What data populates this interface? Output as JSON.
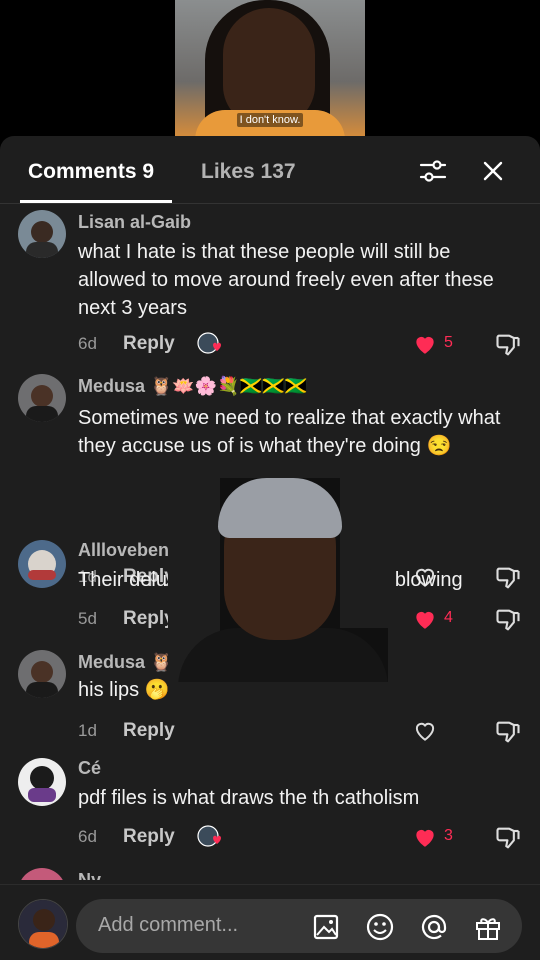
{
  "video": {
    "caption": "I don't know."
  },
  "tabs": {
    "comments_label": "Comments 9",
    "likes_label": "Likes 137"
  },
  "icons": {
    "filter": "sliders-icon",
    "close": "close-icon",
    "like": "heart-icon",
    "dislike": "thumbs-down-icon",
    "creator": "creator-loved-badge-icon",
    "image": "image-icon",
    "emoji": "emoji-icon",
    "mention": "at-sign-icon",
    "gift": "gift-icon"
  },
  "colors": {
    "like_active": "#fe2c55",
    "background": "#1e1e1e"
  },
  "comments": [
    {
      "name": "Lisan al-Gaib",
      "text": "what I hate is that these people will still be allowed to move around freely even after these next 3 years",
      "age": "6d",
      "reply": "Reply",
      "likes": "5",
      "liked": true,
      "creator_liked": true
    },
    {
      "name": "Medusa 🦉🪷🌸💐🇯🇲🇯🇲🇯🇲",
      "text": "Sometimes we need to realize that exactly what they accuse us of is what they're doing 😒",
      "age": "1d",
      "reply": "Reply",
      "likes": "",
      "liked": false,
      "creator_liked": false
    },
    {
      "name": "Allloveben",
      "text": "Their delusion is unbelievably mind blowing",
      "age": "5d",
      "reply": "Reply",
      "likes": "4",
      "liked": true,
      "creator_liked": true
    },
    {
      "name": "Medusa 🦉",
      "text": "his lips 🫢",
      "age": "1d",
      "reply": "Reply",
      "likes": "",
      "liked": false,
      "creator_liked": false
    },
    {
      "name": "Cé",
      "text": "pdf files is what draws the th catholism",
      "age": "6d",
      "reply": "Reply",
      "likes": "3",
      "liked": true,
      "creator_liked": true
    },
    {
      "name": "Ny",
      "text": "",
      "age": "",
      "reply": "",
      "likes": "",
      "liked": false,
      "creator_liked": false
    }
  ],
  "composer": {
    "placeholder": "Add comment..."
  }
}
